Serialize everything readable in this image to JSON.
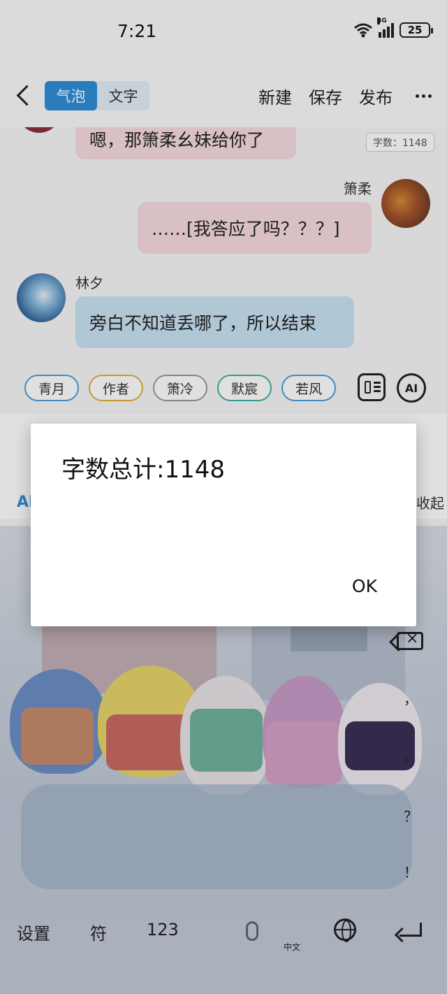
{
  "status_bar": {
    "time": "7:21",
    "network": "4G",
    "battery": "25"
  },
  "toolbar": {
    "tabs": [
      {
        "label": "气泡",
        "active": true
      },
      {
        "label": "文字",
        "active": false
      }
    ],
    "new_label": "新建",
    "save_label": "保存",
    "publish_label": "发布"
  },
  "chat": {
    "word_count_badge": "字数：1148",
    "messages": [
      {
        "text": "嗯，那箫柔幺妹给你了",
        "side": "left",
        "bubble_color": "#f7dbe1"
      },
      {
        "name": "箫柔",
        "text": "……[我答应了吗？？？]",
        "side": "right",
        "bubble_color": "#f7dbe1"
      },
      {
        "name": "林夕",
        "text": "旁白不知道丢哪了，所以结束",
        "side": "left",
        "bubble_color": "#c9e3f4"
      }
    ]
  },
  "roles": [
    "青月",
    "作者",
    "箫冷",
    "默宸",
    "若风"
  ],
  "ai_button_label": "AI",
  "input_row": {
    "ai_label": "AI",
    "collapse_label": "收起"
  },
  "keyboard": {
    "settings_label": "设置",
    "symbols_label": "符",
    "numbers_label": "123",
    "language_label": "中文",
    "side_keys": [
      "，",
      "。",
      "？",
      "！"
    ]
  },
  "dialog": {
    "title": "字数总计:1148",
    "ok_label": "OK"
  },
  "colors": {
    "accent": "#2f8fd8",
    "pink_bubble": "#f7dbe1",
    "blue_bubble": "#c9e3f4"
  }
}
